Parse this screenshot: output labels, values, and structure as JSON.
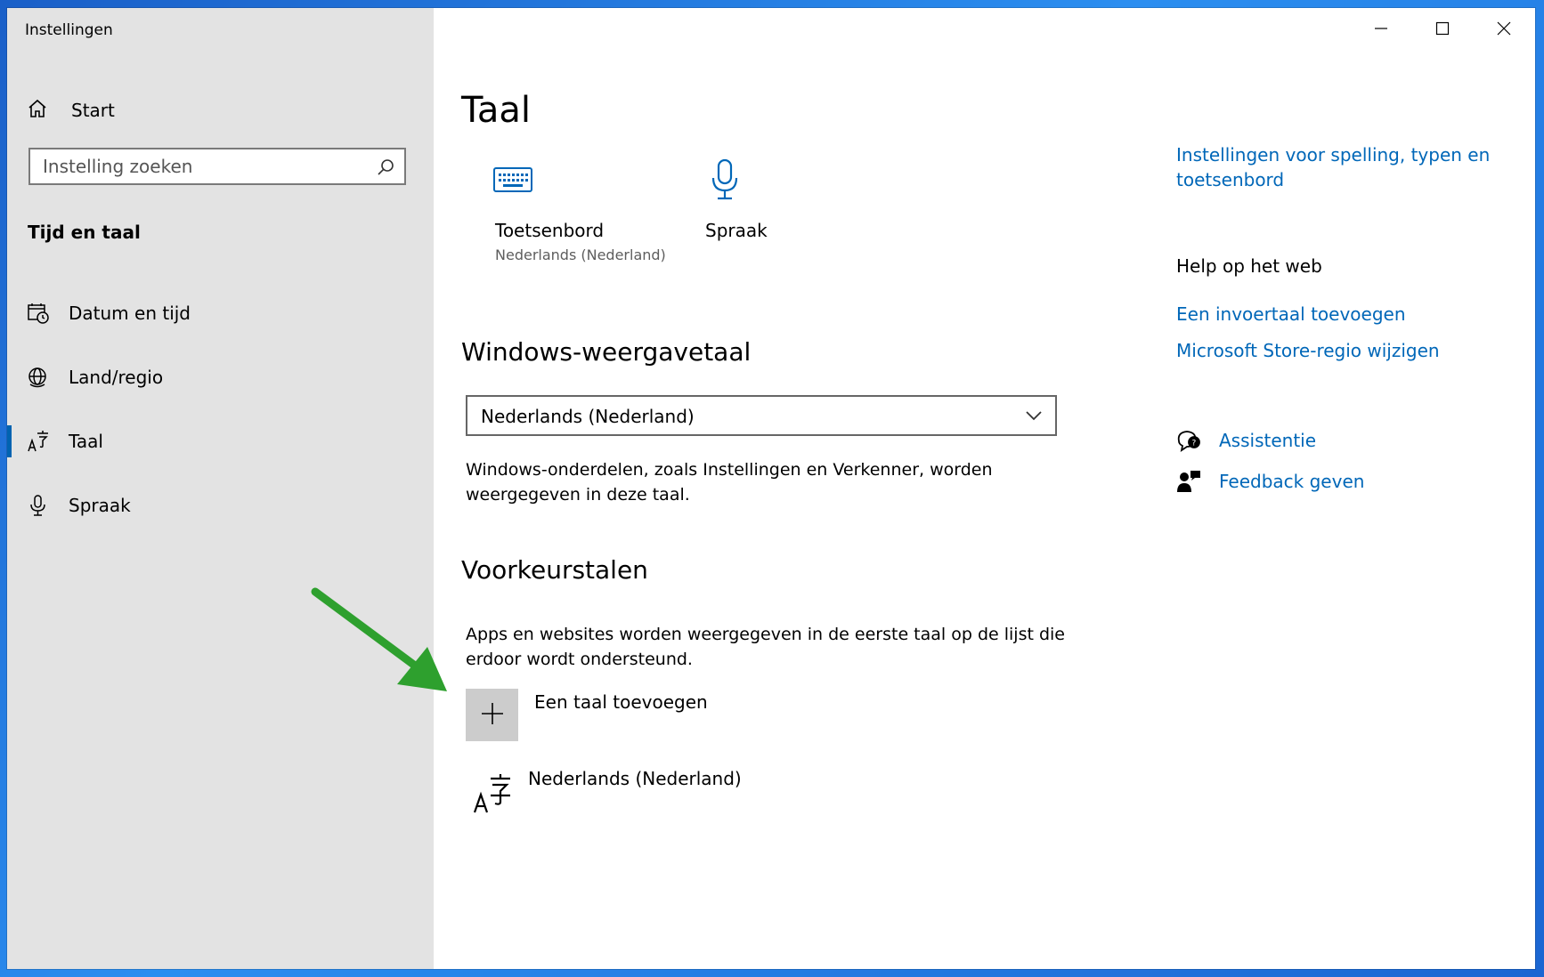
{
  "window": {
    "title": "Instellingen",
    "controls": [
      "minimize",
      "maximize",
      "close"
    ]
  },
  "sidebar": {
    "home_label": "Start",
    "search_placeholder": "Instelling zoeken",
    "section_title": "Tijd en taal",
    "items": [
      {
        "label": "Datum en tijd",
        "icon": "calendar-clock-icon"
      },
      {
        "label": "Land/regio",
        "icon": "globe-icon"
      },
      {
        "label": "Taal",
        "icon": "language-icon",
        "active": true
      },
      {
        "label": "Spraak",
        "icon": "microphone-icon"
      }
    ]
  },
  "main": {
    "title": "Taal",
    "quick": {
      "keyboard_title": "Toetsenbord",
      "keyboard_sub": "Nederlands (Nederland)",
      "speech_title": "Spraak"
    },
    "display_language": {
      "heading": "Windows-weergavetaal",
      "selected": "Nederlands (Nederland)",
      "desc_line1": "Windows-onderdelen, zoals Instellingen en Verkenner, worden",
      "desc_line2": "weergegeven in deze taal."
    },
    "preferred": {
      "heading": "Voorkeurstalen",
      "desc_line1": "Apps en websites worden weergegeven in de eerste taal op de lijst die",
      "desc_line2": "erdoor wordt ondersteund.",
      "add_label": "Een taal toevoegen",
      "languages": [
        "Nederlands (Nederland)"
      ]
    }
  },
  "aside": {
    "spelling_link_line1": "Instellingen voor spelling, typen en",
    "spelling_link_line2": "toetsenbord",
    "help_heading": "Help op het web",
    "help_links": [
      "Een invoertaal toevoegen",
      "Microsoft Store-regio wijzigen"
    ],
    "assist_label": "Assistentie",
    "feedback_label": "Feedback geven"
  },
  "colors": {
    "accent": "#0063b1",
    "link": "#0067b8",
    "sidebar_bg": "#e3e3e3",
    "arrow": "#2ea02e"
  }
}
